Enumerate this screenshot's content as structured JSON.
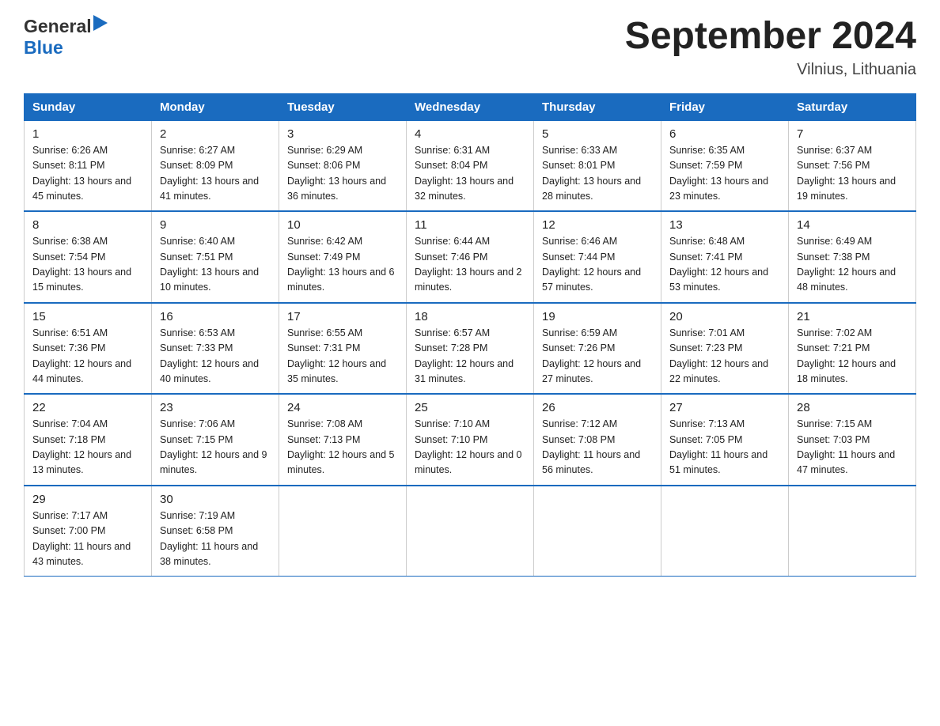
{
  "header": {
    "logo_general": "General",
    "logo_blue": "Blue",
    "main_title": "September 2024",
    "subtitle": "Vilnius, Lithuania"
  },
  "days_of_week": [
    "Sunday",
    "Monday",
    "Tuesday",
    "Wednesday",
    "Thursday",
    "Friday",
    "Saturday"
  ],
  "weeks": [
    [
      {
        "day": "1",
        "sunrise": "6:26 AM",
        "sunset": "8:11 PM",
        "daylight": "13 hours and 45 minutes."
      },
      {
        "day": "2",
        "sunrise": "6:27 AM",
        "sunset": "8:09 PM",
        "daylight": "13 hours and 41 minutes."
      },
      {
        "day": "3",
        "sunrise": "6:29 AM",
        "sunset": "8:06 PM",
        "daylight": "13 hours and 36 minutes."
      },
      {
        "day": "4",
        "sunrise": "6:31 AM",
        "sunset": "8:04 PM",
        "daylight": "13 hours and 32 minutes."
      },
      {
        "day": "5",
        "sunrise": "6:33 AM",
        "sunset": "8:01 PM",
        "daylight": "13 hours and 28 minutes."
      },
      {
        "day": "6",
        "sunrise": "6:35 AM",
        "sunset": "7:59 PM",
        "daylight": "13 hours and 23 minutes."
      },
      {
        "day": "7",
        "sunrise": "6:37 AM",
        "sunset": "7:56 PM",
        "daylight": "13 hours and 19 minutes."
      }
    ],
    [
      {
        "day": "8",
        "sunrise": "6:38 AM",
        "sunset": "7:54 PM",
        "daylight": "13 hours and 15 minutes."
      },
      {
        "day": "9",
        "sunrise": "6:40 AM",
        "sunset": "7:51 PM",
        "daylight": "13 hours and 10 minutes."
      },
      {
        "day": "10",
        "sunrise": "6:42 AM",
        "sunset": "7:49 PM",
        "daylight": "13 hours and 6 minutes."
      },
      {
        "day": "11",
        "sunrise": "6:44 AM",
        "sunset": "7:46 PM",
        "daylight": "13 hours and 2 minutes."
      },
      {
        "day": "12",
        "sunrise": "6:46 AM",
        "sunset": "7:44 PM",
        "daylight": "12 hours and 57 minutes."
      },
      {
        "day": "13",
        "sunrise": "6:48 AM",
        "sunset": "7:41 PM",
        "daylight": "12 hours and 53 minutes."
      },
      {
        "day": "14",
        "sunrise": "6:49 AM",
        "sunset": "7:38 PM",
        "daylight": "12 hours and 48 minutes."
      }
    ],
    [
      {
        "day": "15",
        "sunrise": "6:51 AM",
        "sunset": "7:36 PM",
        "daylight": "12 hours and 44 minutes."
      },
      {
        "day": "16",
        "sunrise": "6:53 AM",
        "sunset": "7:33 PM",
        "daylight": "12 hours and 40 minutes."
      },
      {
        "day": "17",
        "sunrise": "6:55 AM",
        "sunset": "7:31 PM",
        "daylight": "12 hours and 35 minutes."
      },
      {
        "day": "18",
        "sunrise": "6:57 AM",
        "sunset": "7:28 PM",
        "daylight": "12 hours and 31 minutes."
      },
      {
        "day": "19",
        "sunrise": "6:59 AM",
        "sunset": "7:26 PM",
        "daylight": "12 hours and 27 minutes."
      },
      {
        "day": "20",
        "sunrise": "7:01 AM",
        "sunset": "7:23 PM",
        "daylight": "12 hours and 22 minutes."
      },
      {
        "day": "21",
        "sunrise": "7:02 AM",
        "sunset": "7:21 PM",
        "daylight": "12 hours and 18 minutes."
      }
    ],
    [
      {
        "day": "22",
        "sunrise": "7:04 AM",
        "sunset": "7:18 PM",
        "daylight": "12 hours and 13 minutes."
      },
      {
        "day": "23",
        "sunrise": "7:06 AM",
        "sunset": "7:15 PM",
        "daylight": "12 hours and 9 minutes."
      },
      {
        "day": "24",
        "sunrise": "7:08 AM",
        "sunset": "7:13 PM",
        "daylight": "12 hours and 5 minutes."
      },
      {
        "day": "25",
        "sunrise": "7:10 AM",
        "sunset": "7:10 PM",
        "daylight": "12 hours and 0 minutes."
      },
      {
        "day": "26",
        "sunrise": "7:12 AM",
        "sunset": "7:08 PM",
        "daylight": "11 hours and 56 minutes."
      },
      {
        "day": "27",
        "sunrise": "7:13 AM",
        "sunset": "7:05 PM",
        "daylight": "11 hours and 51 minutes."
      },
      {
        "day": "28",
        "sunrise": "7:15 AM",
        "sunset": "7:03 PM",
        "daylight": "11 hours and 47 minutes."
      }
    ],
    [
      {
        "day": "29",
        "sunrise": "7:17 AM",
        "sunset": "7:00 PM",
        "daylight": "11 hours and 43 minutes."
      },
      {
        "day": "30",
        "sunrise": "7:19 AM",
        "sunset": "6:58 PM",
        "daylight": "11 hours and 38 minutes."
      },
      null,
      null,
      null,
      null,
      null
    ]
  ],
  "labels": {
    "sunrise": "Sunrise:",
    "sunset": "Sunset:",
    "daylight": "Daylight:"
  }
}
